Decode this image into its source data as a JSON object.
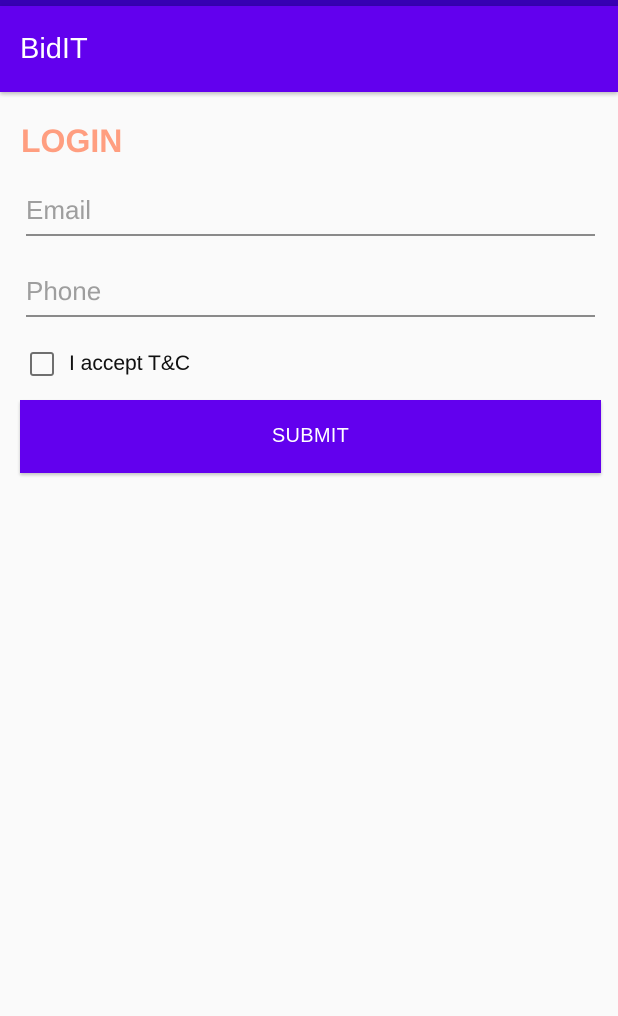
{
  "app": {
    "title": "BidIT"
  },
  "login": {
    "heading": "LOGIN",
    "email_placeholder": "Email",
    "phone_placeholder": "Phone",
    "accept_label": "I accept T&C",
    "submit_label": "SUBMIT"
  },
  "colors": {
    "primary": "#6200ee",
    "status_bar": "#3700b3",
    "heading": "#ff9e80",
    "background": "#fafafa"
  }
}
